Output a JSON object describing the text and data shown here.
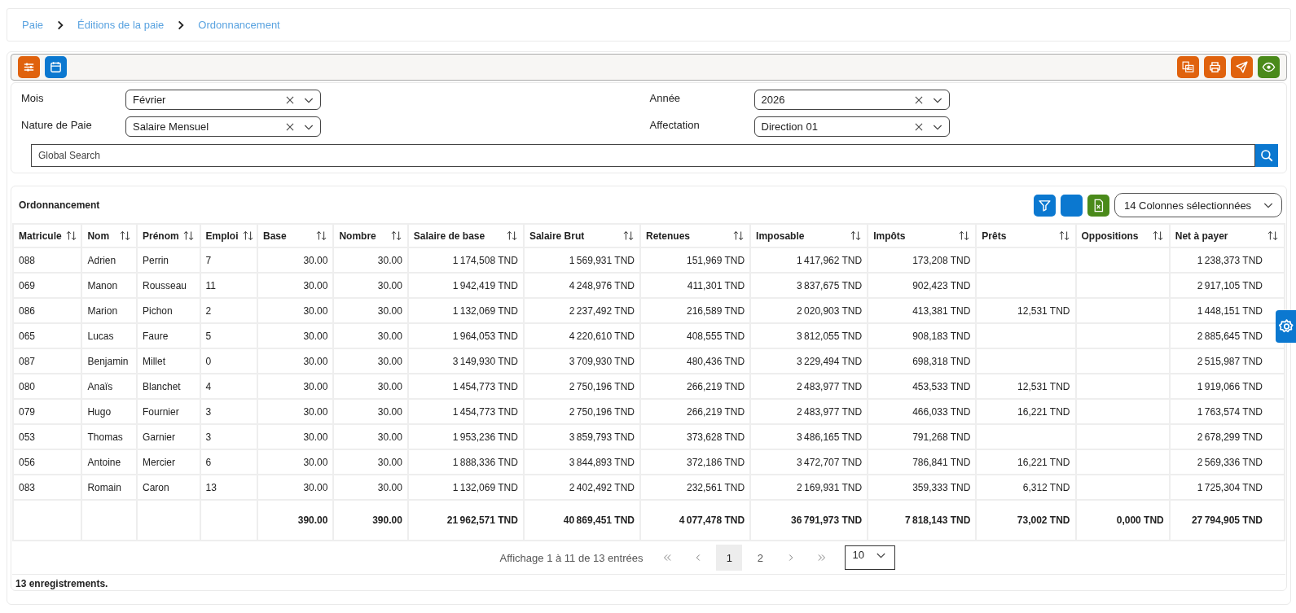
{
  "breadcrumb": [
    {
      "label": "Paie"
    },
    {
      "label": "Éditions de la paie"
    },
    {
      "label": "Ordonnancement"
    }
  ],
  "filters": [
    {
      "label": "Mois",
      "value": "Février"
    },
    {
      "label": "Année",
      "value": "2026"
    },
    {
      "label": "Nature de Paie",
      "value": "Salaire Mensuel"
    },
    {
      "label": "Affectation",
      "value": "Direction 01"
    }
  ],
  "search": {
    "placeholder": "Global Search"
  },
  "table": {
    "title": "Ordonnancement",
    "column_picker": "14 Colonnes sélectionnées",
    "columns": [
      {
        "label": "Matricule",
        "kind": "text"
      },
      {
        "label": "Nom",
        "kind": "text"
      },
      {
        "label": "Prénom",
        "kind": "text"
      },
      {
        "label": "Emploi",
        "kind": "text"
      },
      {
        "label": "Base",
        "kind": "amount"
      },
      {
        "label": "Nombre",
        "kind": "amount"
      },
      {
        "label": "Salaire de base",
        "kind": "amount"
      },
      {
        "label": "Salaire Brut",
        "kind": "amount"
      },
      {
        "label": "Retenues",
        "kind": "amount"
      },
      {
        "label": "Imposable",
        "kind": "amount"
      },
      {
        "label": "Impôts",
        "kind": "amount"
      },
      {
        "label": "Prêts",
        "kind": "amount"
      },
      {
        "label": "Oppositions",
        "kind": "amount"
      },
      {
        "label": "Net à payer",
        "kind": "amount"
      }
    ],
    "rows": [
      [
        "088",
        "Adrien",
        "Perrin",
        "7",
        "30.00",
        "30.00",
        "1 174,508 TND",
        "1 569,931 TND",
        "151,969 TND",
        "1 417,962 TND",
        "173,208 TND",
        null,
        null,
        "1 238,373 TND"
      ],
      [
        "069",
        "Manon",
        "Rousseau",
        "11",
        "30.00",
        "30.00",
        "1 942,419 TND",
        "4 248,976 TND",
        "411,301 TND",
        "3 837,675 TND",
        "902,423 TND",
        null,
        null,
        "2 917,105 TND"
      ],
      [
        "086",
        "Marion",
        "Pichon",
        "2",
        "30.00",
        "30.00",
        "1 132,069 TND",
        "2 237,492 TND",
        "216,589 TND",
        "2 020,903 TND",
        "413,381 TND",
        "12,531 TND",
        null,
        "1 448,151 TND"
      ],
      [
        "065",
        "Lucas",
        "Faure",
        "5",
        "30.00",
        "30.00",
        "1 964,053 TND",
        "4 220,610 TND",
        "408,555 TND",
        "3 812,055 TND",
        "908,183 TND",
        null,
        null,
        "2 885,645 TND"
      ],
      [
        "087",
        "Benjamin",
        "Millet",
        "0",
        "30.00",
        "30.00",
        "3 149,930 TND",
        "3 709,930 TND",
        "480,436 TND",
        "3 229,494 TND",
        "698,318 TND",
        null,
        null,
        "2 515,987 TND"
      ],
      [
        "080",
        "Anaïs",
        "Blanchet",
        "4",
        "30.00",
        "30.00",
        "1 454,773 TND",
        "2 750,196 TND",
        "266,219 TND",
        "2 483,977 TND",
        "453,533 TND",
        "12,531 TND",
        null,
        "1 919,066 TND"
      ],
      [
        "079",
        "Hugo",
        "Fournier",
        "3",
        "30.00",
        "30.00",
        "1 454,773 TND",
        "2 750,196 TND",
        "266,219 TND",
        "2 483,977 TND",
        "466,033 TND",
        "16,221 TND",
        null,
        "1 763,574 TND"
      ],
      [
        "053",
        "Thomas",
        "Garnier",
        "3",
        "30.00",
        "30.00",
        "1 953,236 TND",
        "3 859,793 TND",
        "373,628 TND",
        "3 486,165 TND",
        "791,268 TND",
        null,
        null,
        "2 678,299 TND"
      ],
      [
        "056",
        "Antoine",
        "Mercier",
        "6",
        "30.00",
        "30.00",
        "1 888,336 TND",
        "3 844,893 TND",
        "372,186 TND",
        "3 472,707 TND",
        "786,841 TND",
        "16,221 TND",
        null,
        "2 569,336 TND"
      ],
      [
        "083",
        "Romain",
        "Caron",
        "13",
        "30.00",
        "30.00",
        "1 132,069 TND",
        "2 402,492 TND",
        "232,561 TND",
        "2 169,931 TND",
        "359,333 TND",
        "6,312 TND",
        null,
        "1 725,304 TND"
      ]
    ],
    "totals": [
      "390.00",
      "390.00",
      "21 962,571 TND",
      "40 869,451 TND",
      "4 077,478 TND",
      "36 791,973 TND",
      "7 818,143 TND",
      "73,002 TND",
      "0,000 TND",
      "27 794,905 TND"
    ]
  },
  "pagination": {
    "info": "Affichage 1 à 11 de 13 entrées",
    "pages": [
      {
        "label": "1",
        "selected": true
      },
      {
        "label": "2",
        "selected": false
      }
    ],
    "page_size": "10"
  },
  "footer": "13 enregistrements."
}
